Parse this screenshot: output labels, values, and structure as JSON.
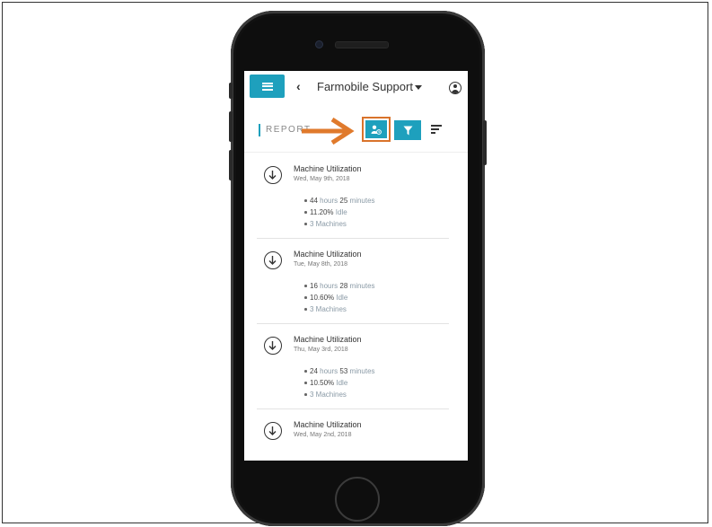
{
  "header": {
    "account_name": "Farmobile Support",
    "menu_icon": "hamburger-icon",
    "back_icon": "chevron-left-icon",
    "profile_icon": "account-circle-icon"
  },
  "toolbar": {
    "section_label": "REPORT",
    "schedule_icon": "person-clock-icon",
    "filter_icon": "filter-icon",
    "sort_icon": "sort-icon"
  },
  "colors": {
    "accent": "#1ea0bd",
    "highlight": "#d9732b"
  },
  "reports": [
    {
      "title": "Machine Utilization",
      "date": "Wed, May 9th, 2018",
      "hours": "44",
      "hours_unit": "hours",
      "minutes": "25",
      "minutes_unit": "minutes",
      "idle": "11.20%",
      "idle_label": "Idle",
      "machines": "3 Machines"
    },
    {
      "title": "Machine Utilization",
      "date": "Tue, May 8th, 2018",
      "hours": "16",
      "hours_unit": "hours",
      "minutes": "28",
      "minutes_unit": "minutes",
      "idle": "10.60%",
      "idle_label": "Idle",
      "machines": "3 Machines"
    },
    {
      "title": "Machine Utilization",
      "date": "Thu, May 3rd, 2018",
      "hours": "24",
      "hours_unit": "hours",
      "minutes": "53",
      "minutes_unit": "minutes",
      "idle": "10.50%",
      "idle_label": "Idle",
      "machines": "3 Machines"
    },
    {
      "title": "Machine Utilization",
      "date": "Wed, May 2nd, 2018"
    }
  ]
}
